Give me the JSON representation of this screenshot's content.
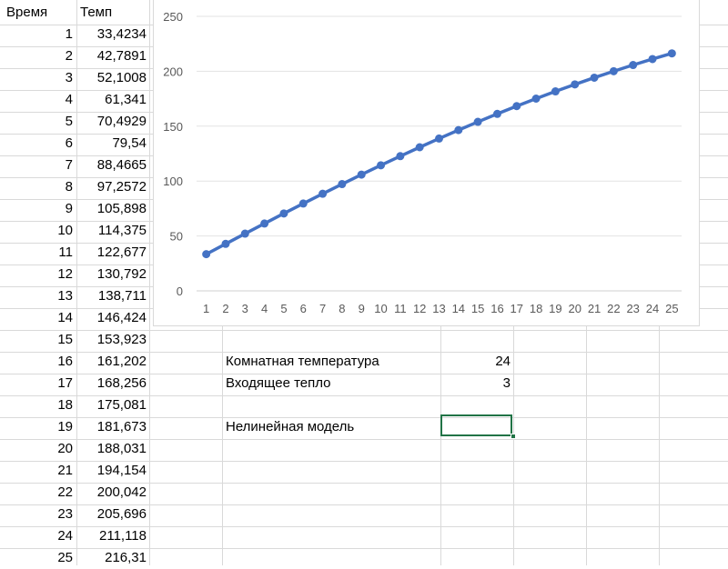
{
  "sheet": {
    "headers": {
      "time": "Время",
      "temp": "Темп"
    },
    "rows": [
      {
        "time": "1",
        "temp": "33,4234"
      },
      {
        "time": "2",
        "temp": "42,7891"
      },
      {
        "time": "3",
        "temp": "52,1008"
      },
      {
        "time": "4",
        "temp": "61,341"
      },
      {
        "time": "5",
        "temp": "70,4929"
      },
      {
        "time": "6",
        "temp": "79,54"
      },
      {
        "time": "7",
        "temp": "88,4665"
      },
      {
        "time": "8",
        "temp": "97,2572"
      },
      {
        "time": "9",
        "temp": "105,898"
      },
      {
        "time": "10",
        "temp": "114,375"
      },
      {
        "time": "11",
        "temp": "122,677"
      },
      {
        "time": "12",
        "temp": "130,792"
      },
      {
        "time": "13",
        "temp": "138,711"
      },
      {
        "time": "14",
        "temp": "146,424"
      },
      {
        "time": "15",
        "temp": "153,923"
      },
      {
        "time": "16",
        "temp": "161,202"
      },
      {
        "time": "17",
        "temp": "168,256"
      },
      {
        "time": "18",
        "temp": "175,081"
      },
      {
        "time": "19",
        "temp": "181,673"
      },
      {
        "time": "20",
        "temp": "188,031"
      },
      {
        "time": "21",
        "temp": "194,154"
      },
      {
        "time": "22",
        "temp": "200,042"
      },
      {
        "time": "23",
        "temp": "205,696"
      },
      {
        "time": "24",
        "temp": "211,118"
      },
      {
        "time": "25",
        "temp": "216,31"
      }
    ],
    "params": {
      "room_temp_label": "Комнатная температура",
      "room_temp_value": "24",
      "heat_input_label": "Входящее тепло",
      "heat_input_value": "3",
      "nonlinear_label": "Нелинейная модель"
    }
  },
  "chart_data": {
    "type": "line",
    "title": "",
    "xlabel": "",
    "ylabel": "",
    "categories": [
      "1",
      "2",
      "3",
      "4",
      "5",
      "6",
      "7",
      "8",
      "9",
      "10",
      "11",
      "12",
      "13",
      "14",
      "15",
      "16",
      "17",
      "18",
      "19",
      "20",
      "21",
      "22",
      "23",
      "24",
      "25"
    ],
    "values": [
      33.4234,
      42.7891,
      52.1008,
      61.341,
      70.4929,
      79.54,
      88.4665,
      97.2572,
      105.898,
      114.375,
      122.677,
      130.792,
      138.711,
      146.424,
      153.923,
      161.202,
      168.256,
      175.081,
      181.673,
      188.031,
      194.154,
      200.042,
      205.696,
      211.118,
      216.31
    ],
    "ylim": [
      0,
      250
    ],
    "yticks": [
      "0",
      "50",
      "100",
      "150",
      "200",
      "250"
    ],
    "grid": true,
    "legend": "none",
    "series_color": "#4472c4",
    "markers": true
  }
}
